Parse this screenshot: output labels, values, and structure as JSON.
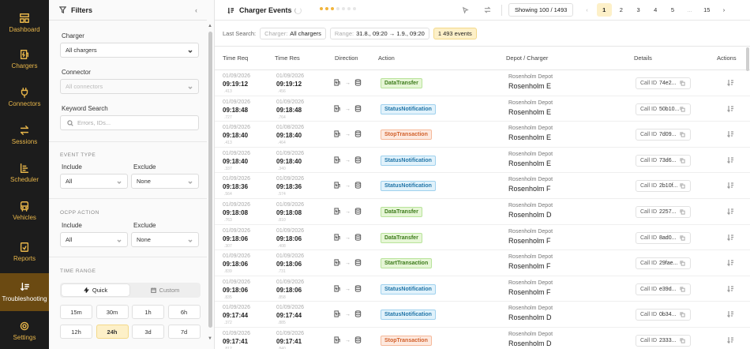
{
  "nav": [
    {
      "label": "Dashboard",
      "icon": "dashboard-icon"
    },
    {
      "label": "Chargers",
      "icon": "charger-icon"
    },
    {
      "label": "Connectors",
      "icon": "plug-icon"
    },
    {
      "label": "Sessions",
      "icon": "sessions-icon"
    },
    {
      "label": "Scheduler",
      "icon": "scheduler-icon"
    },
    {
      "label": "Vehicles",
      "icon": "vehicle-icon"
    },
    {
      "label": "Reports",
      "icon": "reports-icon"
    },
    {
      "label": "Troubleshooting",
      "icon": "troubleshooting-icon"
    },
    {
      "label": "Settings",
      "icon": "settings-icon"
    }
  ],
  "filters": {
    "title": "Filters",
    "collapse_glyph": "‹",
    "charger_label": "Charger",
    "charger_value": "All chargers",
    "connector_label": "Connector",
    "connector_value": "All connectors",
    "keyword_label": "Keyword Search",
    "keyword_placeholder": "Errors, IDs...",
    "event_type_title": "EVENT TYPE",
    "ocpp_action_title": "OCPP ACTION",
    "include_label": "Include",
    "exclude_label": "Exclude",
    "include_value": "All",
    "exclude_value": "None",
    "time_range_title": "TIME RANGE",
    "quick_label": "Quick",
    "custom_label": "Custom",
    "quick_options": [
      "15m",
      "30m",
      "1h",
      "6h",
      "12h",
      "24h",
      "3d",
      "7d"
    ],
    "selected_quick": "24h"
  },
  "topbar": {
    "title": "Charger Events",
    "showing": "Showing 100 / 1493",
    "pages": [
      "‹",
      "1",
      "2",
      "3",
      "4",
      "5",
      "...",
      "15",
      "›"
    ],
    "current_page": "1"
  },
  "search_summary": {
    "label": "Last Search:",
    "charger_key": "Charger:",
    "charger_value": "All chargers",
    "range_key": "Range:",
    "range_value": "31.8., 09:20 → 1.9., 09:20",
    "count": "1 493 events"
  },
  "columns": [
    "Time Req",
    "Time Res",
    "Direction",
    "Action",
    "Depot / Charger",
    "Details",
    "Actions"
  ],
  "rows": [
    {
      "req_date": "01/09/2026",
      "req_time": "09:19:12",
      "req_ms": ".413",
      "res_date": "01/09/2026",
      "res_time": "09:19:12",
      "res_ms": ".456",
      "action": "DataTransfer",
      "action_color": "green",
      "depot": "Rosenholm Depot",
      "charger": "Rosenholm E",
      "call_key": "Call ID",
      "call_id": "74e2..."
    },
    {
      "req_date": "01/09/2026",
      "req_time": "09:18:48",
      "req_ms": ".727",
      "res_date": "01/09/2026",
      "res_time": "09:18:48",
      "res_ms": ".764",
      "action": "StatusNotification",
      "action_color": "blue",
      "depot": "Rosenholm Depot",
      "charger": "Rosenholm E",
      "call_key": "Call ID",
      "call_id": "50b10..."
    },
    {
      "req_date": "01/09/2026",
      "req_time": "09:18:40",
      "req_ms": ".413",
      "res_date": "01/08/2026",
      "res_time": "09:18:40",
      "res_ms": ".464",
      "action": "StopTransaction",
      "action_color": "orange",
      "depot": "Rosenholm Depot",
      "charger": "Rosenholm E",
      "call_key": "Call ID",
      "call_id": "7d09..."
    },
    {
      "req_date": "01/09/2026",
      "req_time": "09:18:40",
      "req_ms": ".337",
      "res_date": "01/09/2026",
      "res_time": "09:18:40",
      "res_ms": ".340",
      "action": "StatusNotification",
      "action_color": "blue",
      "depot": "Rosenholm Depot",
      "charger": "Rosenholm E",
      "call_key": "Call ID",
      "call_id": "73d6..."
    },
    {
      "req_date": "01/09/2026",
      "req_time": "09:18:36",
      "req_ms": ".564",
      "res_date": "01/09/2026",
      "res_time": "09:18:36",
      "res_ms": ".574",
      "action": "StatusNotification",
      "action_color": "blue",
      "depot": "Rosenholm Depot",
      "charger": "Rosenholm F",
      "call_key": "Call ID",
      "call_id": "2b10f..."
    },
    {
      "req_date": "01/09/2026",
      "req_time": "09:18:08",
      "req_ms": ".763",
      "res_date": "01/09/2026",
      "res_time": "09:18:08",
      "res_ms": ".810",
      "action": "DataTransfer",
      "action_color": "green",
      "depot": "Rosenholm Depot",
      "charger": "Rosenholm D",
      "call_key": "Call ID",
      "call_id": "2257..."
    },
    {
      "req_date": "01/09/2026",
      "req_time": "09:18:06",
      "req_ms": ".307",
      "res_date": "01/09/2026",
      "res_time": "09:18:06",
      "res_ms": ".408",
      "action": "DataTransfer",
      "action_color": "green",
      "depot": "Rosenholm Depot",
      "charger": "Rosenholm F",
      "call_key": "Call ID",
      "call_id": "8ad0..."
    },
    {
      "req_date": "01/09/2026",
      "req_time": "09:18:06",
      "req_ms": ".839",
      "res_date": "01/09/2026",
      "res_time": "09:18:06",
      "res_ms": ".731",
      "action": "StartTransaction",
      "action_color": "green",
      "depot": "Rosenholm Depot",
      "charger": "Rosenholm F",
      "call_key": "Call ID",
      "call_id": "29fae..."
    },
    {
      "req_date": "01/09/2026",
      "req_time": "09:18:06",
      "req_ms": ".835",
      "res_date": "01/09/2026",
      "res_time": "09:18:06",
      "res_ms": ".858",
      "action": "StatusNotification",
      "action_color": "blue",
      "depot": "Rosenholm Depot",
      "charger": "Rosenholm F",
      "call_key": "Call ID",
      "call_id": "e39d..."
    },
    {
      "req_date": "01/09/2026",
      "req_time": "09:17:44",
      "req_ms": ".372",
      "res_date": "01/09/2026",
      "res_time": "09:17:44",
      "res_ms": ".885",
      "action": "StatusNotification",
      "action_color": "blue",
      "depot": "Rosenholm Depot",
      "charger": "Rosenholm D",
      "call_key": "Call ID",
      "call_id": "0b34..."
    },
    {
      "req_date": "01/09/2026",
      "req_time": "09:17:41",
      "req_ms": ".812",
      "res_date": "01/09/2026",
      "res_time": "09:17:41",
      "res_ms": ".840",
      "action": "StopTransaction",
      "action_color": "orange",
      "depot": "Rosenholm Depot",
      "charger": "Rosenholm D",
      "call_key": "Call ID",
      "call_id": "2333..."
    }
  ],
  "colors": {
    "accent": "#e8b64a",
    "nav_bg": "#1c1c1c",
    "nav_active": "#6b4a12",
    "highlight": "#fdf0c8"
  }
}
